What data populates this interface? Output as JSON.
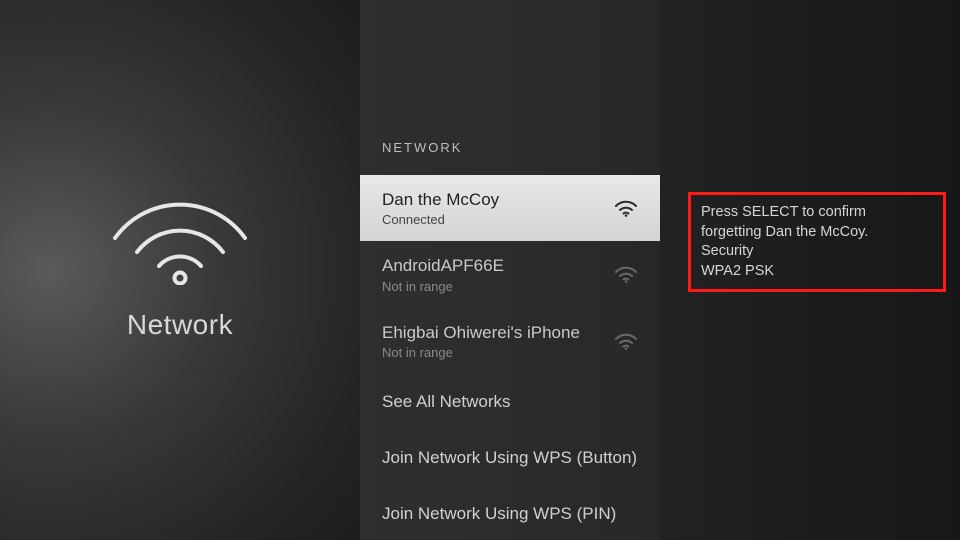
{
  "left": {
    "title": "Network"
  },
  "mid": {
    "section_header": "NETWORK",
    "networks": [
      {
        "name": "Dan the McCoy",
        "status": "Connected",
        "signal": "strong",
        "selected": true
      },
      {
        "name": "AndroidAPF66E",
        "status": "Not in range",
        "signal": "weak",
        "selected": false
      },
      {
        "name": "Ehigbai Ohiwerei's iPhone",
        "status": "Not in range",
        "signal": "weak",
        "selected": false
      }
    ],
    "actions": [
      "See All Networks",
      "Join Network Using WPS (Button)",
      "Join Network Using WPS (PIN)"
    ]
  },
  "right": {
    "info_line1": "Press SELECT to confirm",
    "info_line2": "forgetting Dan the McCoy.",
    "info_security_label": "Security",
    "info_security_value": "WPA2 PSK"
  }
}
